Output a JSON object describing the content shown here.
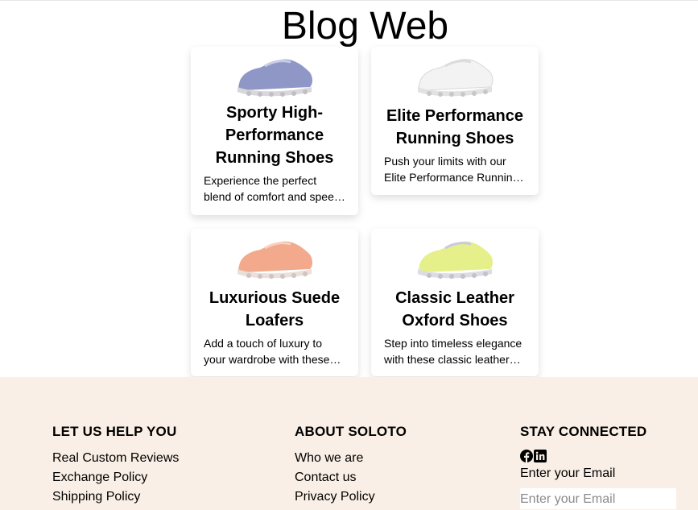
{
  "header": {
    "title": "Blog Web"
  },
  "posts": [
    {
      "title": "Sporty High-Performance Running Shoes",
      "excerpt": "Experience the perfect blend of comfort and speed with these sporty high-performance running shoes",
      "shoe_color": "#8f97c7",
      "image_icon": "shoe-image"
    },
    {
      "title": "Elite Performance Running Shoes",
      "excerpt": "Push your limits with our Elite Performance Running Shoes",
      "shoe_color": "#f4f4f4",
      "image_icon": "shoe-image"
    },
    {
      "title": "Luxurious Suede Loafers",
      "excerpt": "Add a touch of luxury to your wardrobe with these suede loafers",
      "shoe_color": "#f2a98c",
      "image_icon": "shoe-image"
    },
    {
      "title": "Classic Leather Oxford Shoes",
      "excerpt": "Step into timeless elegance with these classic leather oxford shoes",
      "shoe_color": "#e6f08a",
      "image_icon": "shoe-image"
    }
  ],
  "footer": {
    "help": {
      "heading": "LET US HELP YOU",
      "links": [
        "Real Custom Reviews",
        "Exchange Policy",
        "Shipping Policy"
      ]
    },
    "about": {
      "heading": "ABOUT SOLOTO",
      "links": [
        "Who we are",
        "Contact us",
        "Privacy Policy"
      ]
    },
    "connect": {
      "heading": "STAY CONNECTED",
      "icons": [
        "facebook-icon",
        "linkedin-icon"
      ],
      "email_label": "Enter your Email",
      "email_placeholder": "Enter your Email",
      "email_value": ""
    },
    "background": "#f9efe6"
  }
}
